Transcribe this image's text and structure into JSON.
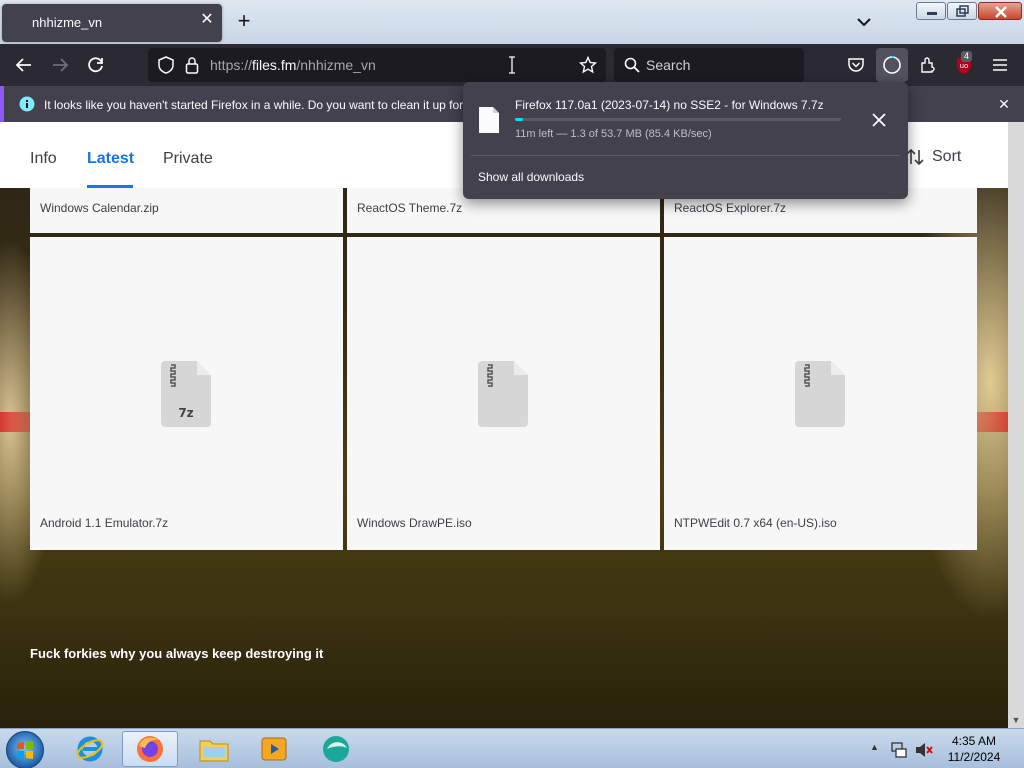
{
  "browser": {
    "tab_title": "nhhizme_vn",
    "url_prefix": "https://",
    "url_domain": "files.fm",
    "url_path": "/nhhizme_vn",
    "search_placeholder": "Search",
    "ublock_count": "4"
  },
  "notification": {
    "text": "It looks like you haven't started Firefox in a while. Do you want to clean it up for"
  },
  "downloads": {
    "file_name": "Firefox 117.0a1 (2023-07-14) no SSE2 - for Windows 7.7z",
    "status": "11m left — 1.3 of 53.7 MB (85.4 KB/sec)",
    "progress_fraction": 0.024,
    "show_all": "Show all downloads"
  },
  "page": {
    "tabs": [
      "Info",
      "Latest",
      "Private"
    ],
    "active_tab": "Latest",
    "sort_label": "Sort",
    "files_top_row": [
      "Windows Calendar.zip",
      "ReactOS Theme.7z",
      "ReactOS Explorer.7z"
    ],
    "files": [
      {
        "name": "Android 1.1 Emulator.7z",
        "icon_label": "7z"
      },
      {
        "name": "Windows DrawPE.iso",
        "icon_label": ""
      },
      {
        "name": "NTPWEdit 0.7 x64 (en-US).iso",
        "icon_label": ""
      }
    ],
    "caption": "Fuck forkies why you always keep destroying it"
  },
  "taskbar": {
    "apps": [
      "internet-explorer",
      "firefox",
      "file-explorer",
      "media-player",
      "app"
    ],
    "time": "4:35 AM",
    "date": "11/2/2024"
  },
  "colors": {
    "accent_blue": "#1a73e8",
    "progress_cyan": "#00ddff",
    "notif_purple": "#9059ff"
  }
}
